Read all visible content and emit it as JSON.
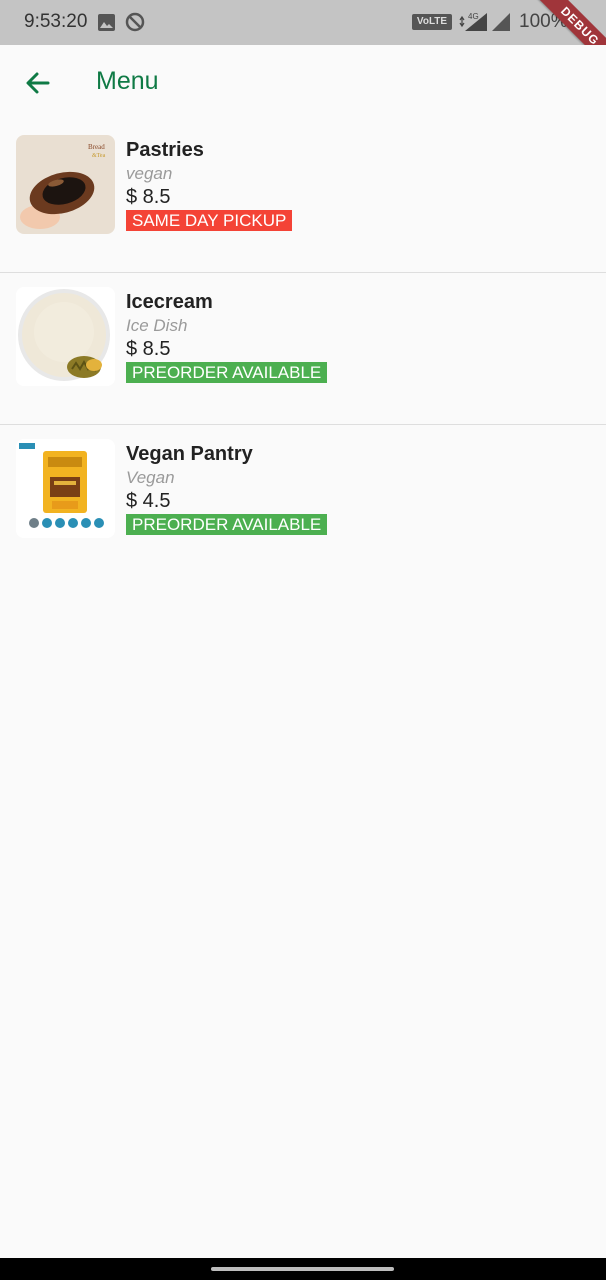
{
  "status_bar": {
    "time": "9:53:20",
    "volte": "VoLTE",
    "network": "4G",
    "battery": "100%",
    "debug_banner": "DEBUG"
  },
  "app_bar": {
    "back_icon": "arrow-back-icon",
    "title": "Menu"
  },
  "colors": {
    "accent": "#0f7a45",
    "same_day": "#f44336",
    "preorder": "#4caf50"
  },
  "menu_items": [
    {
      "name": "Pastries",
      "category": "vegan",
      "price": "$ 8.5",
      "badge": "SAME DAY PICKUP",
      "badge_color": "#f44336"
    },
    {
      "name": "Icecream",
      "category": "Ice Dish",
      "price": "$ 8.5",
      "badge": "PREORDER AVAILABLE",
      "badge_color": "#4caf50"
    },
    {
      "name": "Vegan Pantry",
      "category": "Vegan",
      "price": "$ 4.5",
      "badge": "PREORDER AVAILABLE",
      "badge_color": "#4caf50"
    }
  ]
}
